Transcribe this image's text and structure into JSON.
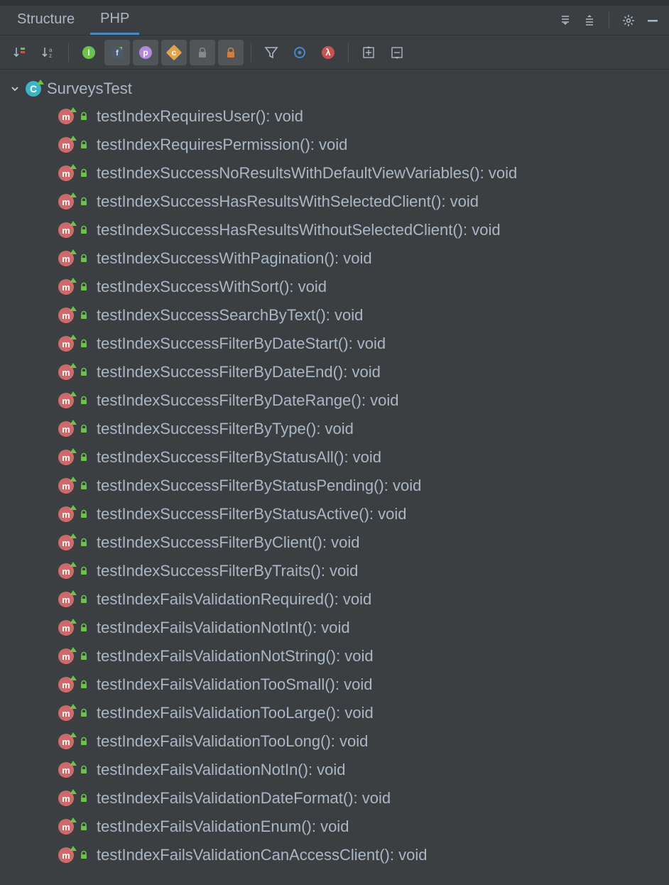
{
  "tabs": {
    "structure_label": "Structure",
    "php_label": "PHP"
  },
  "toolbar": {
    "sort_visibility": "sort-by-visibility",
    "sort_alpha": "sort-alphabetically",
    "show_interfaces": "show-interfaces",
    "show_fields": "show-fields",
    "show_properties": "show-properties",
    "show_constants": "show-constants",
    "show_private": "show-private",
    "show_protected": "show-protected",
    "filter": "filter",
    "autoscroll_source": "autoscroll-to-source",
    "show_lambda": "show-lambda",
    "expand_all": "expand-all",
    "collapse_all": "collapse-all"
  },
  "header_icons": {
    "expand": "expand-all",
    "collapse": "collapse-all",
    "settings": "settings",
    "hide": "hide"
  },
  "tree": {
    "class_name": "SurveysTest",
    "methods": [
      "testIndexRequiresUser(): void",
      "testIndexRequiresPermission(): void",
      "testIndexSuccessNoResultsWithDefaultViewVariables(): void",
      "testIndexSuccessHasResultsWithSelectedClient(): void",
      "testIndexSuccessHasResultsWithoutSelectedClient(): void",
      "testIndexSuccessWithPagination(): void",
      "testIndexSuccessWithSort(): void",
      "testIndexSuccessSearchByText(): void",
      "testIndexSuccessFilterByDateStart(): void",
      "testIndexSuccessFilterByDateEnd(): void",
      "testIndexSuccessFilterByDateRange(): void",
      "testIndexSuccessFilterByType(): void",
      "testIndexSuccessFilterByStatusAll(): void",
      "testIndexSuccessFilterByStatusPending(): void",
      "testIndexSuccessFilterByStatusActive(): void",
      "testIndexSuccessFilterByClient(): void",
      "testIndexSuccessFilterByTraits(): void",
      "testIndexFailsValidationRequired(): void",
      "testIndexFailsValidationNotInt(): void",
      "testIndexFailsValidationNotString(): void",
      "testIndexFailsValidationTooSmall(): void",
      "testIndexFailsValidationTooLarge(): void",
      "testIndexFailsValidationTooLong(): void",
      "testIndexFailsValidationNotIn(): void",
      "testIndexFailsValidationDateFormat(): void",
      "testIndexFailsValidationEnum(): void",
      "testIndexFailsValidationCanAccessClient(): void"
    ]
  }
}
